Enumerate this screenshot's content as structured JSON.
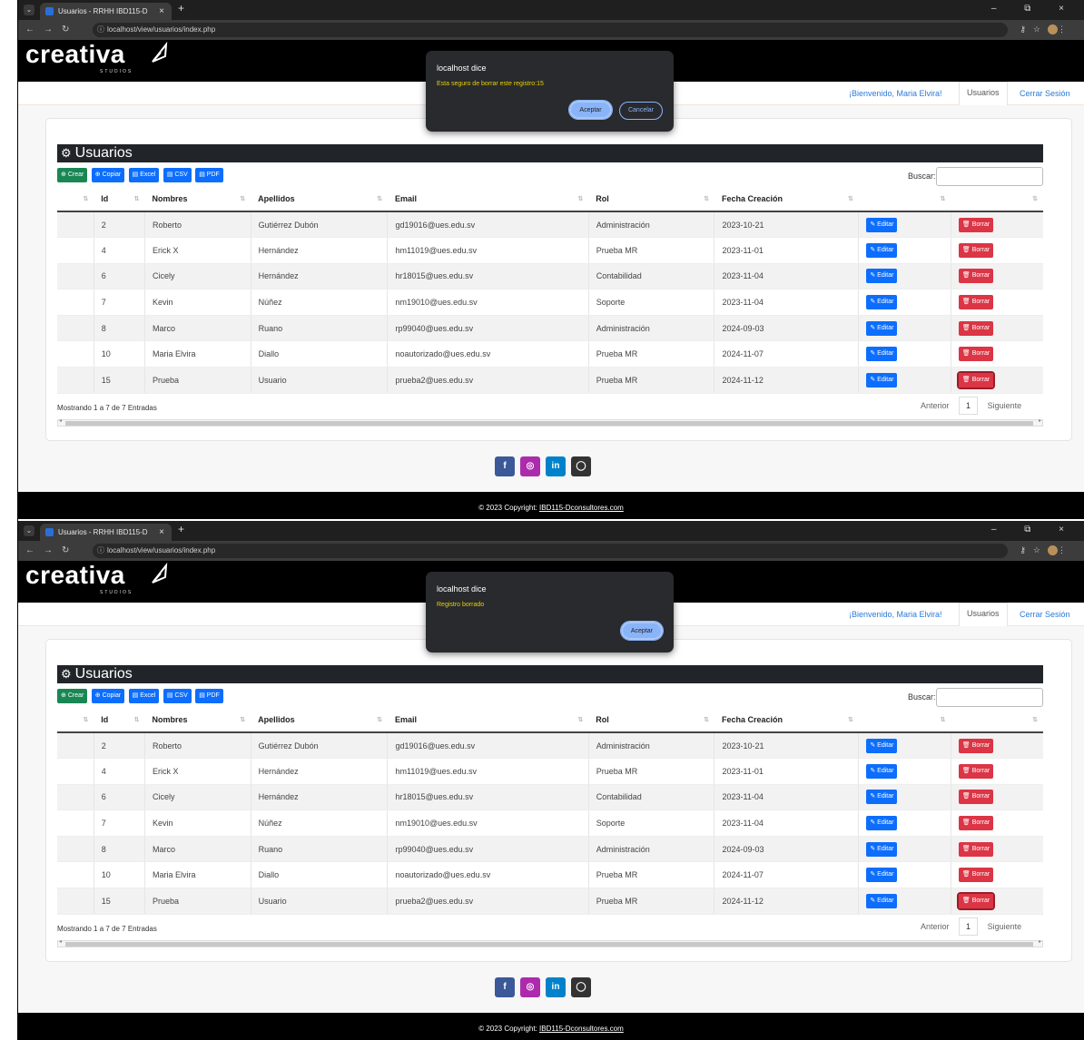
{
  "browser": {
    "tab_title": "Usuarios - RRHH IBD115-D",
    "url": "localhost/view/usuarios/index.php",
    "new_tab": "+",
    "tab_close": "×",
    "window_controls": "– ⧉ ×"
  },
  "site": {
    "logo_text": "creativa",
    "logo_sub": "STUDIOS",
    "nav": {
      "welcome": "¡Bienvenido, Maria Elvira!",
      "users": "Usuarios",
      "logout": "Cerrar Sesión"
    }
  },
  "page": {
    "title": "Usuarios",
    "buttons": {
      "create": "Crear",
      "copy": "Copiar",
      "excel": "Excel",
      "csv": "CSV",
      "pdf": "PDF"
    },
    "search_label": "Buscar:",
    "columns": [
      "Id",
      "Nombres",
      "Apellidos",
      "Email",
      "Rol",
      "Fecha Creación"
    ],
    "edit_label": "Editar",
    "delete_label": "Borrar",
    "rows": [
      {
        "id": "2",
        "nombres": "Roberto",
        "apellidos": "Gutiérrez Dubón",
        "email": "gd19016@ues.edu.sv",
        "rol": "Administración",
        "fecha": "2023-10-21"
      },
      {
        "id": "4",
        "nombres": "Erick X",
        "apellidos": "Hernández",
        "email": "hm11019@ues.edu.sv",
        "rol": "Prueba MR",
        "fecha": "2023-11-01"
      },
      {
        "id": "6",
        "nombres": "Cicely",
        "apellidos": "Hernández",
        "email": "hr18015@ues.edu.sv",
        "rol": "Contabilidad",
        "fecha": "2023-11-04"
      },
      {
        "id": "7",
        "nombres": "Kevin",
        "apellidos": "Núñez",
        "email": "nm19010@ues.edu.sv",
        "rol": "Soporte",
        "fecha": "2023-11-04"
      },
      {
        "id": "8",
        "nombres": "Marco",
        "apellidos": "Ruano",
        "email": "rp99040@ues.edu.sv",
        "rol": "Administración",
        "fecha": "2024-09-03"
      },
      {
        "id": "10",
        "nombres": "Maria Elvira",
        "apellidos": "Diallo",
        "email": "noautorizado@ues.edu.sv",
        "rol": "Prueba MR",
        "fecha": "2024-11-07"
      },
      {
        "id": "15",
        "nombres": "Prueba",
        "apellidos": "Usuario",
        "email": "prueba2@ues.edu.sv",
        "rol": "Prueba MR",
        "fecha": "2024-11-12"
      }
    ],
    "info": "Mostrando 1 a 7 de 7 Entradas",
    "pager": {
      "prev": "Anterior",
      "page": "1",
      "next": "Siguiente"
    }
  },
  "footer": {
    "prefix": "© 2023 Copyright: ",
    "link": "IBD115-Dconsultores.com"
  },
  "dialogs": [
    {
      "title": "localhost dice",
      "message": "Esta seguro de borrar este registro:15",
      "ok": "Aceptar",
      "cancel": "Cancelar"
    },
    {
      "title": "localhost dice",
      "message": "Registro borrado",
      "ok": "Aceptar"
    }
  ],
  "colors": {
    "primary": "#0d6efd",
    "danger": "#dc3545",
    "success": "#198754",
    "dialog_bg": "#292a2d",
    "dialog_accent": "#8ab4f8"
  },
  "icons": [
    "menu-icon",
    "favicon-icon",
    "back-icon",
    "forward-icon",
    "reload-icon",
    "info-icon",
    "password-key-icon",
    "star-icon",
    "profile-icon",
    "kebab-menu-icon",
    "rocket-icon",
    "gear-icon",
    "plus-circle-icon",
    "copy-icon",
    "excel-file-icon",
    "csv-file-icon",
    "pdf-file-icon",
    "edit-icon",
    "trash-icon",
    "facebook-icon",
    "instagram-icon",
    "linkedin-icon",
    "github-icon"
  ]
}
